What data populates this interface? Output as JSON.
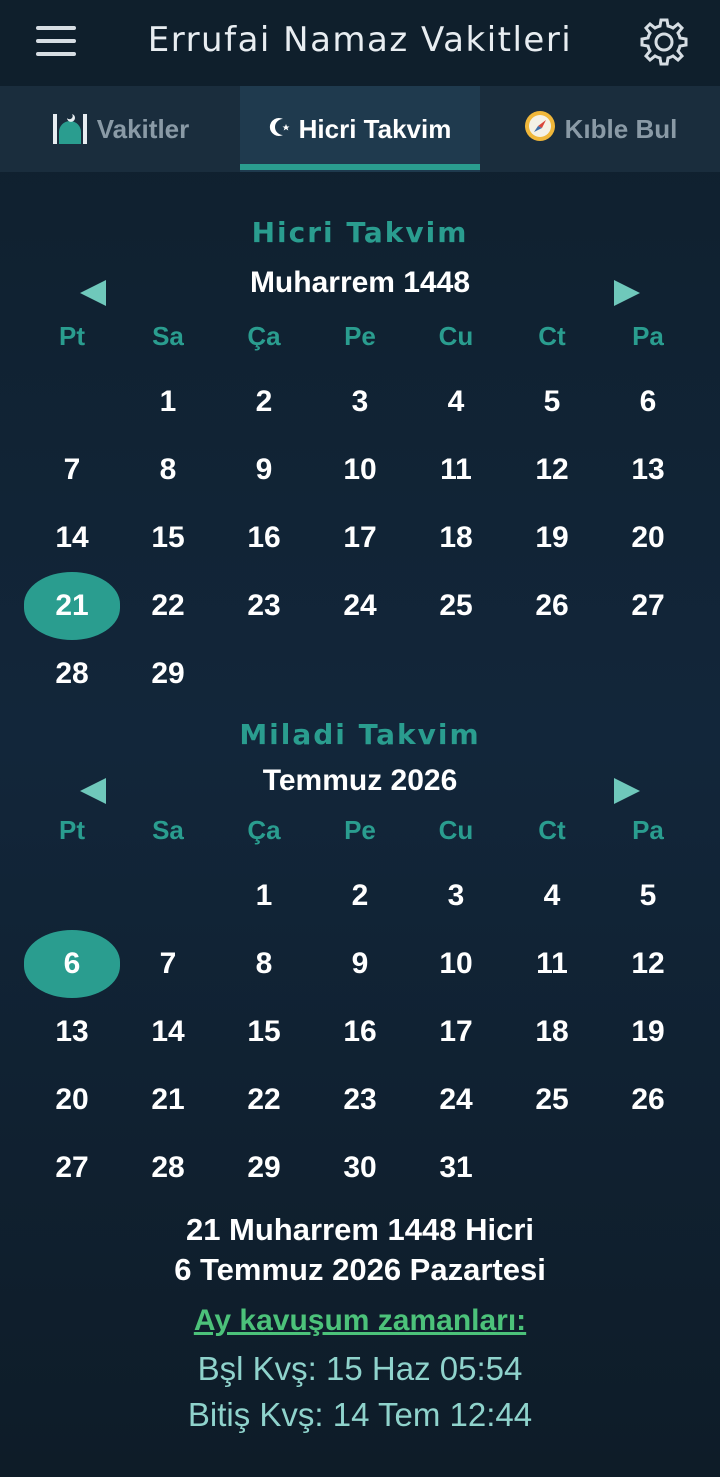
{
  "app": {
    "title": "Errufai Namaz Vakitleri"
  },
  "tabs": [
    {
      "label": "Vakitler",
      "icon": "mosque-icon",
      "active": false
    },
    {
      "label": "Hicri Takvim",
      "icon": "crescent-star-icon",
      "active": true
    },
    {
      "label": "Kıble Bul",
      "icon": "compass-icon",
      "active": false
    }
  ],
  "colors": {
    "accent": "#2a9d8f",
    "background": "#0f1f2c",
    "link_green": "#4cc27a"
  },
  "hijri": {
    "section_title": "Hicri Takvim",
    "month": "Muharrem 1448",
    "weekdays": [
      "Pt",
      "Sa",
      "Ça",
      "Pe",
      "Cu",
      "Ct",
      "Pa"
    ],
    "weeks": [
      [
        "",
        "1",
        "2",
        "3",
        "4",
        "5",
        "6"
      ],
      [
        "7",
        "8",
        "9",
        "10",
        "11",
        "12",
        "13"
      ],
      [
        "14",
        "15",
        "16",
        "17",
        "18",
        "19",
        "20"
      ],
      [
        "21",
        "22",
        "23",
        "24",
        "25",
        "26",
        "27"
      ],
      [
        "28",
        "29",
        "",
        "",
        "",
        "",
        ""
      ]
    ],
    "selected": "21"
  },
  "gregorian": {
    "section_title": "Miladi Takvim",
    "month": "Temmuz 2026",
    "weekdays": [
      "Pt",
      "Sa",
      "Ça",
      "Pe",
      "Cu",
      "Ct",
      "Pa"
    ],
    "weeks": [
      [
        "",
        "",
        "1",
        "2",
        "3",
        "4",
        "5"
      ],
      [
        "6",
        "7",
        "8",
        "9",
        "10",
        "11",
        "12"
      ],
      [
        "13",
        "14",
        "15",
        "16",
        "17",
        "18",
        "19"
      ],
      [
        "20",
        "21",
        "22",
        "23",
        "24",
        "25",
        "26"
      ],
      [
        "27",
        "28",
        "29",
        "30",
        "31",
        "",
        ""
      ]
    ],
    "selected": "6"
  },
  "summary": {
    "hijri_date": "21 Muharrem 1448 Hicri",
    "gregorian_date": "6 Temmuz 2026 Pazartesi",
    "conjunction_title": "Ay kavuşum zamanları:",
    "start": "Bşl Kvş: 15 Haz 05:54",
    "end": "Bitiş Kvş: 14 Tem 12:44"
  }
}
